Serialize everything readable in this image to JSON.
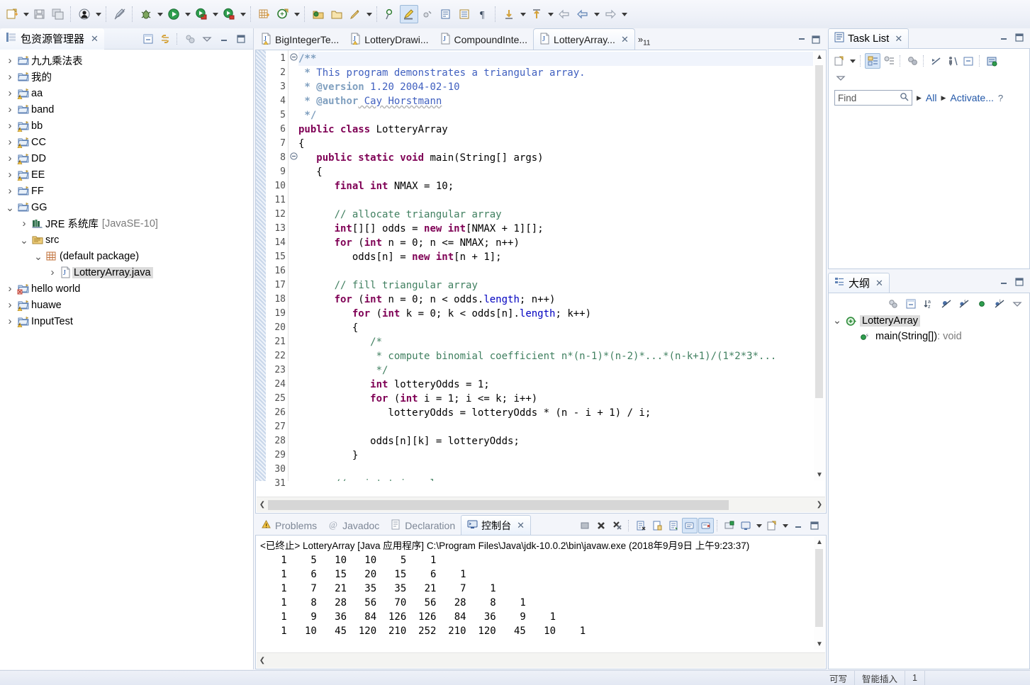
{
  "toolbar": {
    "groups": [
      {
        "items": [
          {
            "name": "new-wizard-icon",
            "glyph": "new"
          },
          {
            "name": "new-dropdown-arrow",
            "glyph": "arrow"
          },
          {
            "name": "save-icon",
            "glyph": "save"
          },
          {
            "name": "save-all-icon",
            "glyph": "saveall"
          }
        ]
      },
      {
        "items": [
          {
            "name": "user-icon",
            "glyph": "user"
          },
          {
            "name": "user-dropdown-arrow",
            "glyph": "arrow"
          }
        ]
      },
      {
        "items": [
          {
            "name": "toggle-mark-occurrences-icon",
            "glyph": "pen"
          }
        ]
      },
      {
        "items": [
          {
            "name": "debug-icon",
            "glyph": "bug"
          },
          {
            "name": "debug-dropdown-arrow",
            "glyph": "arrow"
          },
          {
            "name": "run-icon",
            "glyph": "run"
          },
          {
            "name": "run-dropdown-arrow",
            "glyph": "arrow"
          },
          {
            "name": "run-external-tools-icon",
            "glyph": "extgreen"
          },
          {
            "name": "external-tools-dropdown-arrow",
            "glyph": "arrow"
          },
          {
            "name": "coverage-icon",
            "glyph": "cov"
          },
          {
            "name": "coverage-dropdown-arrow",
            "glyph": "arrow"
          }
        ]
      },
      {
        "items": [
          {
            "name": "new-java-package-icon",
            "glyph": "pkg"
          },
          {
            "name": "new-java-class-icon",
            "glyph": "cls"
          },
          {
            "name": "new-class-dropdown-arrow",
            "glyph": "arrow"
          }
        ]
      },
      {
        "items": [
          {
            "name": "open-type-icon",
            "glyph": "folderopen"
          },
          {
            "name": "open-task-icon",
            "glyph": "folder2"
          },
          {
            "name": "search-icon",
            "glyph": "pencil"
          },
          {
            "name": "search-dropdown-arrow",
            "glyph": "arrow"
          }
        ]
      },
      {
        "items": [
          {
            "name": "pin-icon",
            "glyph": "pin"
          },
          {
            "name": "highlight-icon",
            "glyph": "highlight"
          },
          {
            "name": "skip-breakpoints-icon",
            "glyph": "skip"
          },
          {
            "name": "next-annotation-icon",
            "glyph": "annot"
          },
          {
            "name": "show-whitespace-icon",
            "glyph": "ws"
          },
          {
            "name": "pilcrow-icon",
            "glyph": "pilcrow"
          }
        ]
      },
      {
        "items": [
          {
            "name": "next-edit-icon",
            "glyph": "downarrow"
          },
          {
            "name": "next-edit-dropdown-arrow",
            "glyph": "arrow"
          },
          {
            "name": "prev-edit-icon",
            "glyph": "uparrow"
          },
          {
            "name": "prev-edit-dropdown-arrow",
            "glyph": "arrow"
          },
          {
            "name": "back-history-icon",
            "glyph": "leftarrow-gray"
          },
          {
            "name": "back-icon",
            "glyph": "leftarrow"
          },
          {
            "name": "back-dropdown-arrow",
            "glyph": "arrow"
          },
          {
            "name": "forward-icon",
            "glyph": "rightarrow"
          },
          {
            "name": "forward-dropdown-arrow",
            "glyph": "arrow"
          }
        ]
      }
    ]
  },
  "package_explorer": {
    "title": "包资源管理器",
    "close_glyph": "✕",
    "toolbar": [
      {
        "name": "collapse-all-icon"
      },
      {
        "name": "link-with-editor-icon"
      },
      {
        "name": "view-menu-filter-icon"
      },
      {
        "name": "view-menu-icon"
      },
      {
        "name": "minimize-icon"
      },
      {
        "name": "maximize-icon"
      }
    ],
    "tree": [
      {
        "label": "九九乘法表",
        "indent": 0,
        "twist": "collapsed",
        "icon": "project-folder-icon",
        "selected": false
      },
      {
        "label": "我的",
        "indent": 0,
        "twist": "collapsed",
        "icon": "project-folder-icon",
        "selected": false
      },
      {
        "label": "aa",
        "indent": 0,
        "twist": "collapsed",
        "icon": "project-warning-icon",
        "selected": false
      },
      {
        "label": "band",
        "indent": 0,
        "twist": "collapsed",
        "icon": "project-folder-icon",
        "selected": false
      },
      {
        "label": "bb",
        "indent": 0,
        "twist": "collapsed",
        "icon": "project-warning-icon",
        "selected": false
      },
      {
        "label": "CC",
        "indent": 0,
        "twist": "collapsed",
        "icon": "project-warning-icon",
        "selected": false
      },
      {
        "label": "DD",
        "indent": 0,
        "twist": "collapsed",
        "icon": "project-warning-icon",
        "selected": false
      },
      {
        "label": "EE",
        "indent": 0,
        "twist": "collapsed",
        "icon": "project-warning-icon",
        "selected": false
      },
      {
        "label": "FF",
        "indent": 0,
        "twist": "collapsed",
        "icon": "project-folder-icon",
        "selected": false
      },
      {
        "label": "GG",
        "indent": 0,
        "twist": "expanded",
        "icon": "project-folder-icon",
        "selected": false
      },
      {
        "label": "JRE 系统库",
        "suffix": "[JavaSE-10]",
        "indent": 1,
        "twist": "collapsed",
        "icon": "jre-library-icon",
        "selected": false
      },
      {
        "label": "src",
        "indent": 1,
        "twist": "expanded",
        "icon": "source-folder-icon",
        "selected": false
      },
      {
        "label": "(default package)",
        "indent": 2,
        "twist": "expanded",
        "icon": "package-icon",
        "selected": false
      },
      {
        "label": "LotteryArray.java",
        "indent": 3,
        "twist": "collapsed",
        "icon": "java-file-icon",
        "selected": true
      },
      {
        "label": "hello world",
        "indent": 0,
        "twist": "collapsed",
        "icon": "project-error-icon",
        "selected": false
      },
      {
        "label": "huawe",
        "indent": 0,
        "twist": "collapsed",
        "icon": "project-warning-icon",
        "selected": false
      },
      {
        "label": "InputTest",
        "indent": 0,
        "twist": "collapsed",
        "icon": "project-warning-icon",
        "selected": false
      }
    ]
  },
  "editor": {
    "tabs": [
      {
        "label": "BigIntegerTe...",
        "icon": "java-warning-file-icon",
        "active": false
      },
      {
        "label": "LotteryDrawi...",
        "icon": "java-warning-file-icon",
        "active": false
      },
      {
        "label": "CompoundInte...",
        "icon": "java-file-icon",
        "active": false
      },
      {
        "label": "LotteryArray...",
        "icon": "java-file-icon",
        "active": true
      }
    ],
    "overflow_label": "»",
    "overflow_count": "11",
    "close_glyph": "✕",
    "window_buttons": [
      {
        "name": "restore-icon"
      },
      {
        "name": "maximize-icon"
      }
    ],
    "line_numbers": [
      "1",
      "2",
      "3",
      "4",
      "5",
      "6",
      "7",
      "8",
      "9",
      "10",
      "11",
      "12",
      "13",
      "14",
      "15",
      "16",
      "17",
      "18",
      "19",
      "20",
      "21",
      "22",
      "23",
      "24",
      "25",
      "26",
      "27",
      "28",
      "29",
      "30",
      "31"
    ],
    "fold_markers": {
      "1": "minus",
      "8": "minus"
    },
    "code_lines": [
      [
        {
          "t": "/**",
          "c": "jdt"
        }
      ],
      [
        {
          "t": " * ",
          "c": "jdt"
        },
        {
          "t": "This program demonstrates a triangular array.",
          "c": "jd"
        }
      ],
      [
        {
          "t": " * ",
          "c": "jdt"
        },
        {
          "t": "@version",
          "c": "jdt"
        },
        {
          "t": " 1.20 2004-02-10",
          "c": "jd"
        }
      ],
      [
        {
          "t": " * ",
          "c": "jdt"
        },
        {
          "t": "@author",
          "c": "jdt"
        },
        {
          "t": " Cay Horstmann",
          "c": "jd wavy"
        }
      ],
      [
        {
          "t": " */",
          "c": "jdt"
        }
      ],
      [
        {
          "t": "public class ",
          "c": "kw"
        },
        {
          "t": "LotteryArray",
          "c": ""
        }
      ],
      [
        {
          "t": "{",
          "c": ""
        }
      ],
      [
        {
          "t": "   ",
          "c": ""
        },
        {
          "t": "public static void ",
          "c": "kw"
        },
        {
          "t": "main(String[] args)",
          "c": ""
        }
      ],
      [
        {
          "t": "   {",
          "c": ""
        }
      ],
      [
        {
          "t": "      ",
          "c": ""
        },
        {
          "t": "final int ",
          "c": "kw"
        },
        {
          "t": "NMAX = 10;",
          "c": ""
        }
      ],
      [
        {
          "t": "",
          "c": ""
        }
      ],
      [
        {
          "t": "      ",
          "c": ""
        },
        {
          "t": "// allocate triangular array",
          "c": "cm"
        }
      ],
      [
        {
          "t": "      ",
          "c": ""
        },
        {
          "t": "int",
          "c": "kw"
        },
        {
          "t": "[][] odds = ",
          "c": ""
        },
        {
          "t": "new int",
          "c": "kw"
        },
        {
          "t": "[NMAX + 1][];",
          "c": ""
        }
      ],
      [
        {
          "t": "      ",
          "c": ""
        },
        {
          "t": "for ",
          "c": "kw"
        },
        {
          "t": "(",
          "c": ""
        },
        {
          "t": "int ",
          "c": "kw"
        },
        {
          "t": "n = 0; n <= NMAX; n++)",
          "c": ""
        }
      ],
      [
        {
          "t": "         odds[n] = ",
          "c": ""
        },
        {
          "t": "new int",
          "c": "kw"
        },
        {
          "t": "[n + 1];",
          "c": ""
        }
      ],
      [
        {
          "t": "",
          "c": ""
        }
      ],
      [
        {
          "t": "      ",
          "c": ""
        },
        {
          "t": "// fill triangular array",
          "c": "cm"
        }
      ],
      [
        {
          "t": "      ",
          "c": ""
        },
        {
          "t": "for ",
          "c": "kw"
        },
        {
          "t": "(",
          "c": ""
        },
        {
          "t": "int ",
          "c": "kw"
        },
        {
          "t": "n = 0; n < odds.",
          "c": ""
        },
        {
          "t": "length",
          "c": "fld"
        },
        {
          "t": "; n++)",
          "c": ""
        }
      ],
      [
        {
          "t": "         ",
          "c": ""
        },
        {
          "t": "for ",
          "c": "kw"
        },
        {
          "t": "(",
          "c": ""
        },
        {
          "t": "int ",
          "c": "kw"
        },
        {
          "t": "k = 0; k < odds[n].",
          "c": ""
        },
        {
          "t": "length",
          "c": "fld"
        },
        {
          "t": "; k++)",
          "c": ""
        }
      ],
      [
        {
          "t": "         {",
          "c": ""
        }
      ],
      [
        {
          "t": "            ",
          "c": ""
        },
        {
          "t": "/*",
          "c": "cm"
        }
      ],
      [
        {
          "t": "             ",
          "c": ""
        },
        {
          "t": "* compute binomial coefficient n*(n-1)*(n-2)*...*(n-k+1)/(1*2*3*...",
          "c": "cm"
        }
      ],
      [
        {
          "t": "             ",
          "c": ""
        },
        {
          "t": "*/",
          "c": "cm"
        }
      ],
      [
        {
          "t": "            ",
          "c": ""
        },
        {
          "t": "int ",
          "c": "kw"
        },
        {
          "t": "lotteryOdds = 1;",
          "c": ""
        }
      ],
      [
        {
          "t": "            ",
          "c": ""
        },
        {
          "t": "for ",
          "c": "kw"
        },
        {
          "t": "(",
          "c": ""
        },
        {
          "t": "int ",
          "c": "kw"
        },
        {
          "t": "i = 1; i <= k; i++)",
          "c": ""
        }
      ],
      [
        {
          "t": "               lotteryOdds = lotteryOdds * (n - i + 1) / i;",
          "c": ""
        }
      ],
      [
        {
          "t": "",
          "c": ""
        }
      ],
      [
        {
          "t": "            odds[n][k] = lotteryOdds;",
          "c": ""
        }
      ],
      [
        {
          "t": "         }",
          "c": ""
        }
      ],
      [
        {
          "t": "",
          "c": ""
        }
      ],
      [
        {
          "t": "      ",
          "c": ""
        },
        {
          "t": "// print triangular array",
          "c": "cm"
        }
      ]
    ]
  },
  "console": {
    "tabs": [
      {
        "label": "Problems",
        "icon": "problems-icon",
        "active": false
      },
      {
        "label": "Javadoc",
        "icon": "javadoc-icon",
        "active": false
      },
      {
        "label": "Declaration",
        "icon": "declaration-icon",
        "active": false
      },
      {
        "label": "控制台",
        "icon": "console-icon",
        "active": true
      }
    ],
    "close_glyph": "✕",
    "toolbar": [
      {
        "name": "clear-console-icon"
      },
      {
        "name": "terminate-icon"
      },
      {
        "name": "remove-all-terminated-icon"
      },
      {
        "name": "scroll-lock-icon"
      },
      {
        "name": "pin-console-icon"
      },
      {
        "name": "word-wrap-icon"
      },
      {
        "name": "display-selected-console-icon"
      },
      {
        "name": "show-console-on-output-icon"
      },
      {
        "name": "open-console-icon"
      },
      {
        "name": "pin-view-icon"
      },
      {
        "name": "pin-view-dropdown-arrow"
      },
      {
        "name": "new-console-view-icon"
      },
      {
        "name": "new-console-dropdown-arrow"
      },
      {
        "name": "minimize-icon"
      },
      {
        "name": "maximize-icon"
      }
    ],
    "header": "<已终止> LotteryArray [Java 应用程序] C:\\Program Files\\Java\\jdk-10.0.2\\bin\\javaw.exe  (2018年9月9日 上午9:23:37)",
    "output_lines": [
      "   1    5   10   10    5    1",
      "   1    6   15   20   15    6    1",
      "   1    7   21   35   35   21    7    1",
      "   1    8   28   56   70   56   28    8    1",
      "   1    9   36   84  126  126   84   36    9    1",
      "   1   10   45  120  210  252  210  120   45   10    1"
    ]
  },
  "task_list": {
    "title": "Task List",
    "close_glyph": "✕",
    "toolbar": [
      {
        "name": "new-task-icon"
      },
      {
        "name": "new-task-dropdown-arrow"
      },
      {
        "name": "categorized-mode-icon"
      },
      {
        "name": "scheduled-mode-icon"
      },
      {
        "name": "focus-on-workweek-icon"
      },
      {
        "name": "synchronize-changed-icon"
      },
      {
        "name": "restore-tasks-icon"
      },
      {
        "name": "collapse-all-icon"
      },
      {
        "name": "view-menu-icon"
      }
    ],
    "find_placeholder": "Find",
    "find_value": "",
    "search_icon": "search-icon",
    "links": [
      {
        "label": "All"
      },
      {
        "label": "Activate..."
      }
    ],
    "help_glyph": "?",
    "window_buttons": [
      {
        "name": "minimize-icon"
      },
      {
        "name": "maximize-icon"
      }
    ]
  },
  "outline": {
    "title": "大纲",
    "close_glyph": "✕",
    "toolbar": [
      {
        "name": "focus-on-active-task-icon"
      },
      {
        "name": "collapse-all-icon"
      },
      {
        "name": "sort-alphabetically-icon"
      },
      {
        "name": "hide-fields-icon"
      },
      {
        "name": "hide-static-icon"
      },
      {
        "name": "hide-non-public-icon"
      },
      {
        "name": "hide-local-types-icon"
      },
      {
        "name": "view-menu-icon"
      }
    ],
    "window_buttons": [
      {
        "name": "minimize-icon"
      },
      {
        "name": "maximize-icon"
      }
    ],
    "items": [
      {
        "label": "LotteryArray",
        "indent": 0,
        "twist": "expanded",
        "icon": "class-icon",
        "selected": true,
        "suffix": ""
      },
      {
        "label": "main(String[])",
        "suffix": " : void",
        "indent": 1,
        "twist": "none",
        "icon": "method-public-static-icon",
        "selected": false
      }
    ]
  },
  "status_bar": {
    "writable": "可写",
    "insert_mode": "智能插入",
    "position": "1"
  },
  "colors": {
    "accent": "#2257a8",
    "keyword": "#7f0055",
    "comment": "#3f7f5f",
    "javadoc": "#3f5fbf",
    "field": "#0000c0",
    "selection": "#dcdcdc",
    "panel_border": "#c3d0e2",
    "toolbar_bg": "#eef1f8"
  }
}
